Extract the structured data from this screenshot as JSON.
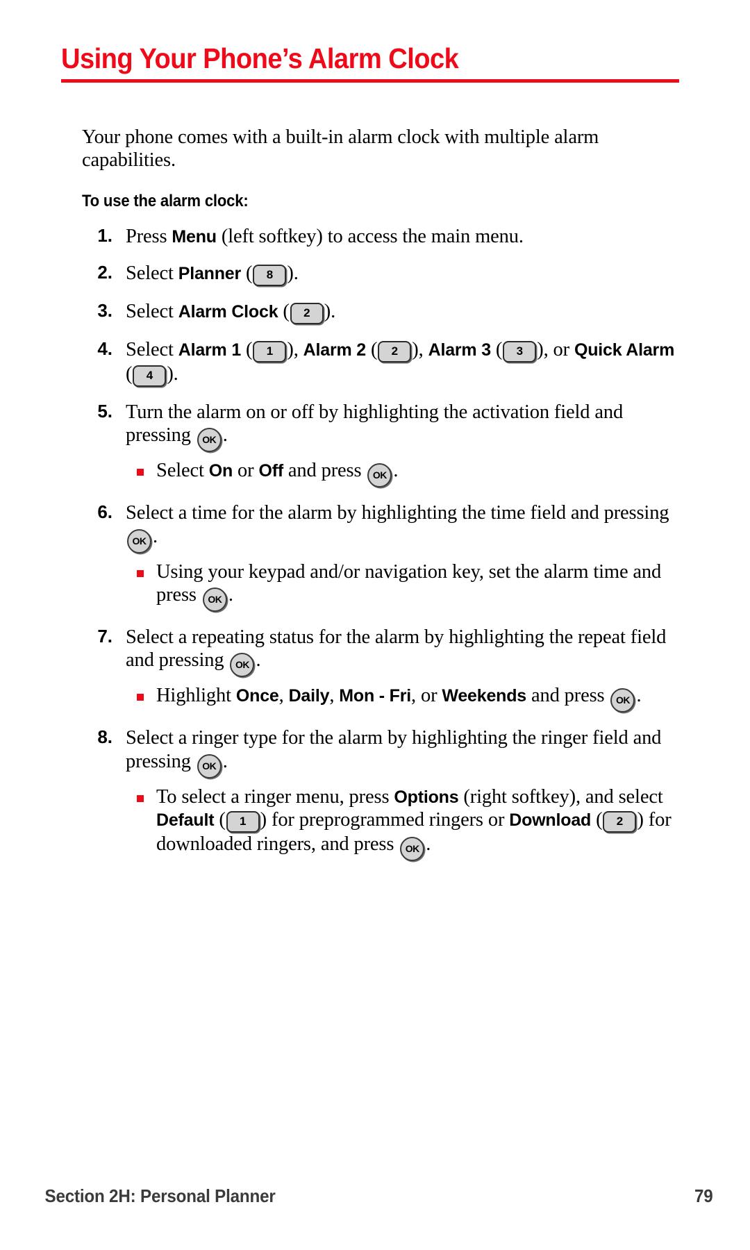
{
  "document": {
    "title": "Using Your Phone’s Alarm Clock",
    "accent_color": "#ef0a19",
    "intro": "Your phone comes with a built-in alarm clock with multiple alarm capabilities.",
    "subhead": "To use the alarm clock:"
  },
  "steps": [
    {
      "number": "1.",
      "parts": {
        "p1": "Press ",
        "kw1": "Menu",
        "p2": " (left softkey) to access the main menu."
      }
    },
    {
      "number": "2.",
      "parts": {
        "p1": "Select ",
        "kw1": "Planner",
        "p2": " (",
        "key1": "8",
        "p3": ")."
      }
    },
    {
      "number": "3.",
      "parts": {
        "p1": "Select ",
        "kw1": "Alarm Clock",
        "p2": " (",
        "key1": "2",
        "p3": ")."
      }
    },
    {
      "number": "4.",
      "parts": {
        "p1": "Select ",
        "kw1": "Alarm 1",
        "p2": " (",
        "key1": "1",
        "p3": "), ",
        "kw2": "Alarm 2",
        "p4": " (",
        "key2": "2",
        "p5": "), ",
        "kw3": "Alarm 3",
        "p6": " (",
        "key3": "3",
        "p7": "), or ",
        "kw4": "Quick Alarm",
        "p8": " (",
        "key4": "4",
        "p9": ")."
      }
    },
    {
      "number": "5.",
      "parts": {
        "p1": "Turn the alarm on or off by highlighting the activation field and pressing ",
        "ok1": "OK",
        "p2": "."
      },
      "subs": [
        {
          "p1": "Select ",
          "kw1": "On",
          "p2": " or ",
          "kw2": "Off",
          "p3": " and press ",
          "ok1": "OK",
          "p4": "."
        }
      ]
    },
    {
      "number": "6.",
      "parts": {
        "p1": "Select a time for the alarm by highlighting the time field and pressing ",
        "ok1": "OK",
        "p2": "."
      },
      "subs": [
        {
          "p1": "Using your keypad and/or navigation key, set the alarm time and press ",
          "ok1": "OK",
          "p2": "."
        }
      ]
    },
    {
      "number": "7.",
      "parts": {
        "p1": "Select a repeating status for the alarm by highlighting the repeat field and pressing ",
        "ok1": "OK",
        "p2": "."
      },
      "subs": [
        {
          "p1": "Highlight ",
          "kw1": "Once",
          "p2": ", ",
          "kw2": "Daily",
          "p3": ", ",
          "kw3": "Mon - Fri",
          "p4": ", or ",
          "kw4": "Weekends",
          "p5": " and press ",
          "ok1": "OK",
          "p6": "."
        }
      ]
    },
    {
      "number": "8.",
      "parts": {
        "p1": "Select a ringer type for the alarm by highlighting the ringer field and pressing ",
        "ok1": "OK",
        "p2": "."
      },
      "subs": [
        {
          "p1": "To select a ringer menu, press ",
          "kw1": "Options",
          "p2": " (right softkey), and select ",
          "kw2": "Default",
          "p3": " (",
          "key1": "1",
          "p4": ") for preprogrammed ringers or ",
          "kw3": "Download",
          "p5": " (",
          "key2": "2",
          "p6": ") for downloaded ringers, and press ",
          "ok1": "OK",
          "p7": "."
        }
      ]
    }
  ],
  "footer": {
    "section": "Section 2H: Personal Planner",
    "page_number": "79"
  }
}
